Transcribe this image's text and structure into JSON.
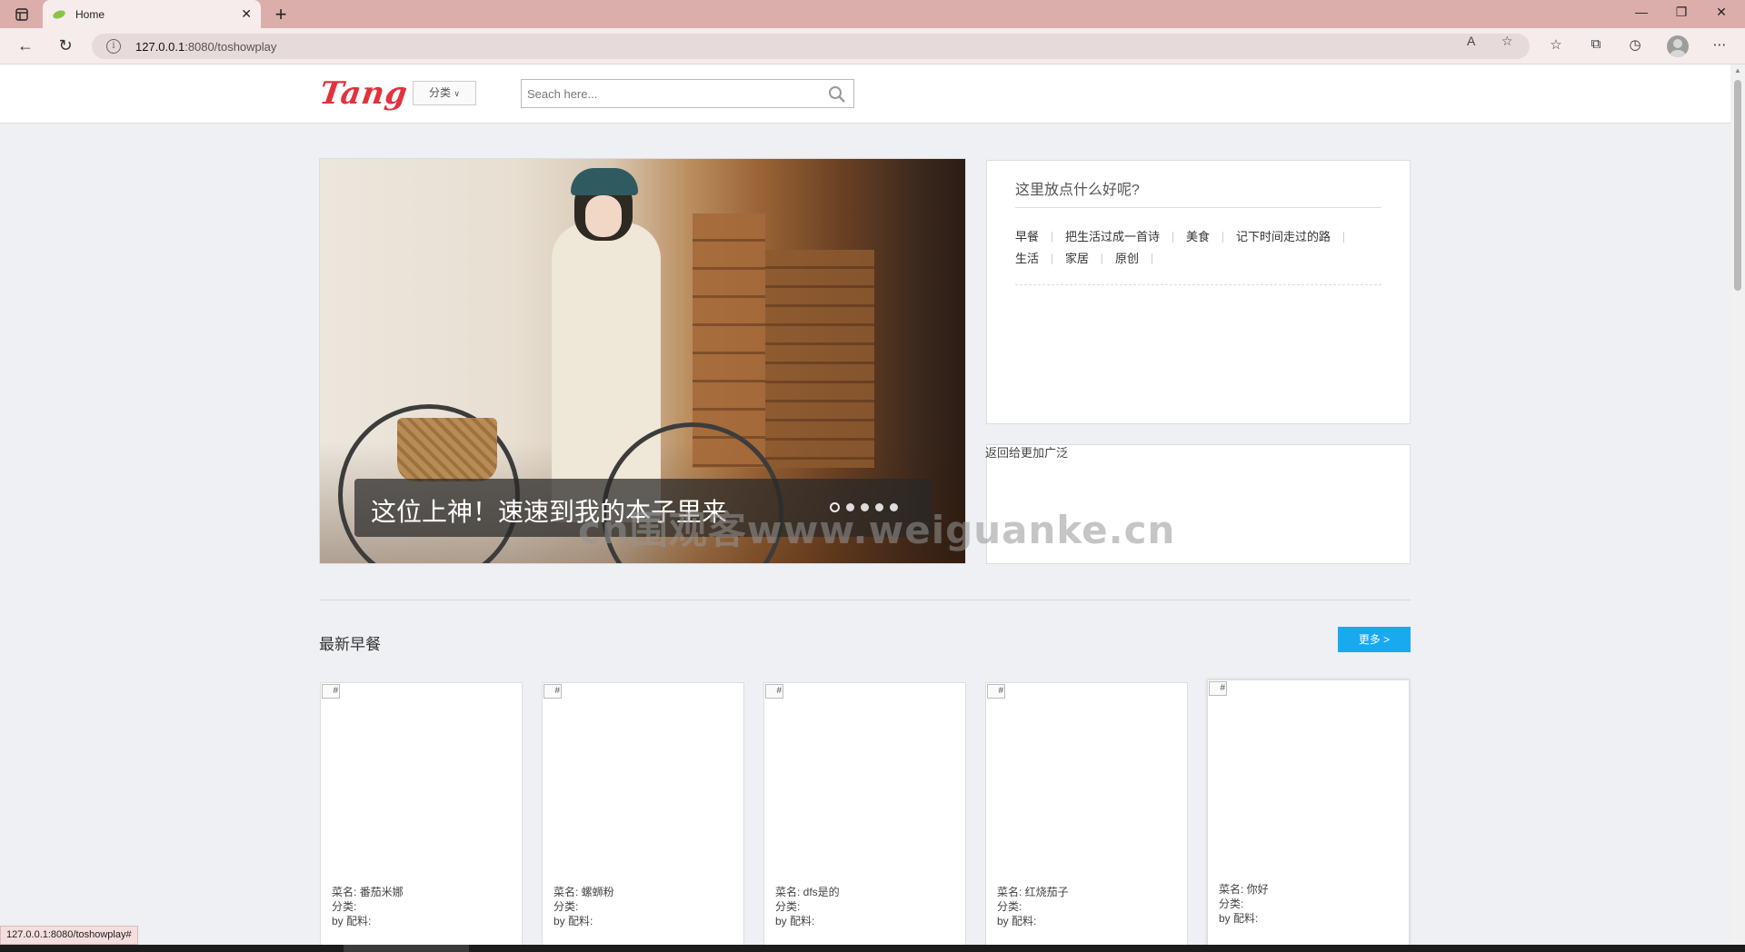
{
  "browser": {
    "tab_title": "Home",
    "url_host": "127.0.0.1",
    "url_rest": ":8080/toshowplay",
    "status_url": "127.0.0.1:8080/toshowplay#"
  },
  "site": {
    "logo": "Tang",
    "category_label": "分类",
    "search_placeholder": "Seach here..."
  },
  "carousel": {
    "caption": "这位上神！速速到我的本子里来",
    "slide_count": 5,
    "active_index": 0
  },
  "sidebar": {
    "panel_title": "这里放点什么好呢?",
    "tags": [
      "早餐",
      "把生活过成一首诗",
      "美食",
      "记下时间走过的路",
      "生活",
      "家居",
      "原创"
    ],
    "ad_text": "返回给更加广泛"
  },
  "section": {
    "title": "最新早餐",
    "more_label": "更多 >"
  },
  "cards": [
    {
      "alt": "#",
      "name_line": "菜名: 番茄米娜",
      "category_line": "分类:",
      "by_line": "by 配料:"
    },
    {
      "alt": "#",
      "name_line": "菜名: 螺蛳粉",
      "category_line": "分类:",
      "by_line": "by 配料:"
    },
    {
      "alt": "#",
      "name_line": "菜名: dfs是的",
      "category_line": "分类:",
      "by_line": "by 配料:"
    },
    {
      "alt": "#",
      "name_line": "菜名: 红烧茄子",
      "category_line": "分类:",
      "by_line": "by 配料:"
    },
    {
      "alt": "#",
      "name_line": "菜名: 你好",
      "category_line": "分类:",
      "by_line": "by 配料:"
    }
  ],
  "watermark": "cn围观客www.weiguanke.cn",
  "colors": {
    "accent": "#18a9ef",
    "logo": "#e3323d",
    "tabbar": "#dcaeab"
  }
}
